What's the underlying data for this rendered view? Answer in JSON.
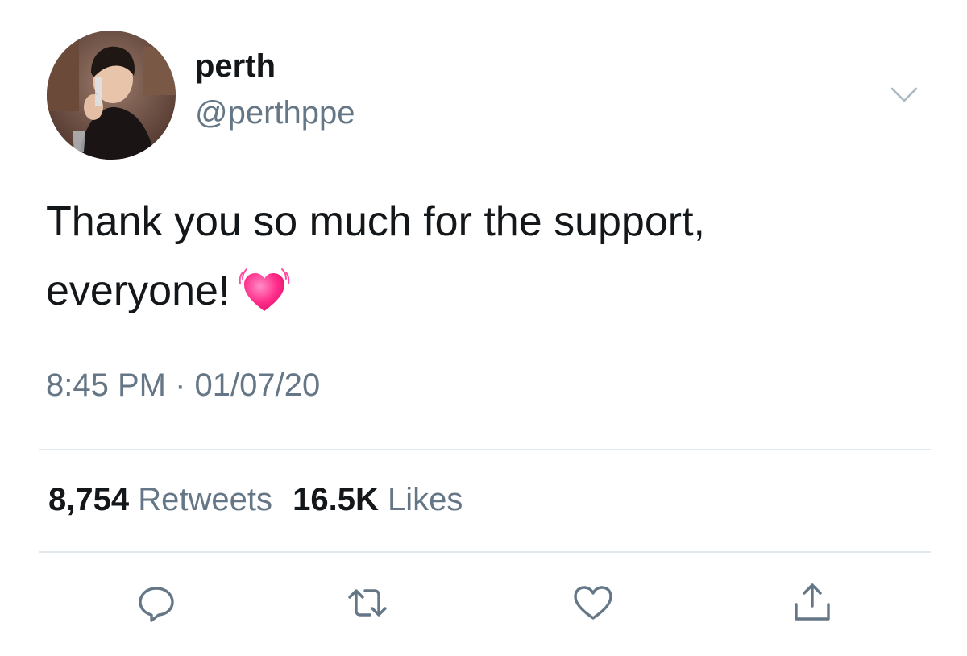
{
  "user": {
    "display_name": "perth",
    "handle": "@perthppe",
    "avatar_icon": "profile-photo"
  },
  "tweet": {
    "text_line1": "Thank you so much for the support,",
    "text_line2": "everyone!",
    "emoji_icon": "beating-heart-emoji",
    "timestamp": "8:45 PM · 01/07/20"
  },
  "stats": {
    "retweets_count": "8,754",
    "retweets_label": "Retweets",
    "likes_count": "16.5K",
    "likes_label": "Likes"
  },
  "actions": [
    "reply-icon",
    "retweet-icon",
    "like-icon",
    "share-icon"
  ],
  "colors": {
    "text": "#14171a",
    "secondary_text": "#657786",
    "divider": "#e1e8ed",
    "emoji_pink": "#ff2d8a"
  }
}
